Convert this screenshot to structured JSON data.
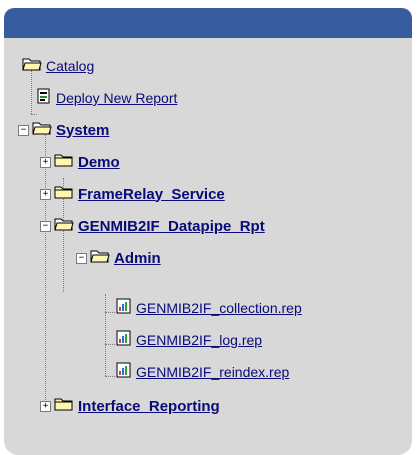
{
  "tree": {
    "root": {
      "label": "Catalog",
      "icon": "folder-open-icon"
    },
    "deploy": {
      "label": "Deploy New Report",
      "icon": "deploy-report-icon"
    },
    "system": {
      "label": "System",
      "icon": "folder-open-icon"
    },
    "demo": {
      "label": "Demo",
      "icon": "folder-closed-icon"
    },
    "framerelay": {
      "label": "FrameRelay_Service",
      "icon": "folder-closed-icon"
    },
    "genmib": {
      "label": "GENMIB2IF_Datapipe_Rpt",
      "icon": "folder-open-icon"
    },
    "admin": {
      "label": "Admin",
      "icon": "folder-open-icon"
    },
    "reports": [
      {
        "label": "GENMIB2IF_collection.rep",
        "icon": "report-icon"
      },
      {
        "label": "GENMIB2IF_log.rep",
        "icon": "report-icon"
      },
      {
        "label": "GENMIB2IF_reindex.rep",
        "icon": "report-icon"
      }
    ],
    "iface": {
      "label": "Interface_Reporting",
      "icon": "folder-closed-icon"
    }
  },
  "colors": {
    "header": "#375c9e",
    "panel": "#d8d8d8",
    "link": "#0a0a78"
  }
}
